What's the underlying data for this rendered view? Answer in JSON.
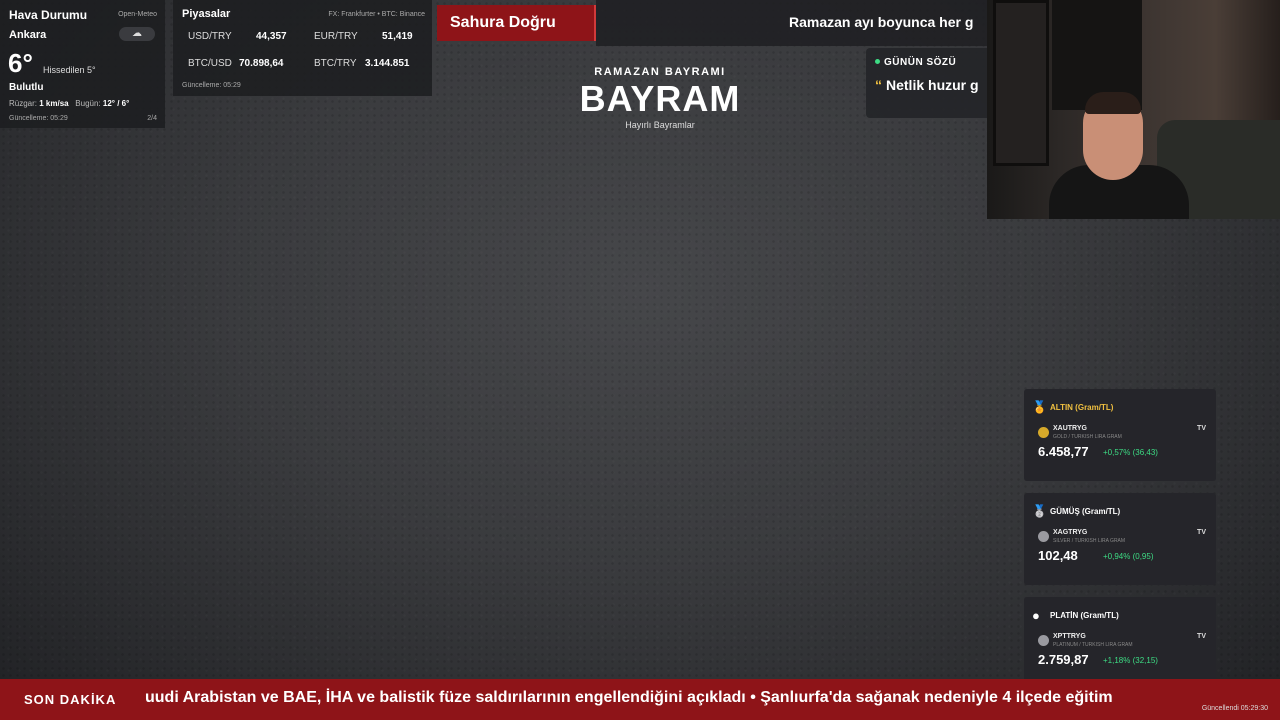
{
  "weather": {
    "title": "Hava Durumu",
    "source": "Open-Meteo",
    "city": "Ankara",
    "icon": "cloud-icon",
    "temperature": "6°",
    "feels_like": "Hissedilen 5°",
    "condition": "Bulutlu",
    "wind_label": "Rüzgar:",
    "wind_value": "1 km/sa",
    "today_label": "Bugün:",
    "today_value": "12° / 6°",
    "updated": "Güncelleme: 05:29",
    "page": "2/4"
  },
  "markets": {
    "title": "Piyasalar",
    "source": "FX: Frankfurter • BTC: Binance",
    "rates": [
      {
        "pair": "USD/TRY",
        "value": "44,357"
      },
      {
        "pair": "EUR/TRY",
        "value": "51,419"
      },
      {
        "pair": "BTC/USD",
        "value": "70.898,64"
      },
      {
        "pair": "BTC/TRY",
        "value": "3.144.851"
      }
    ],
    "updated": "Güncelleme: 05:29"
  },
  "sahur": {
    "label": "Sahura Doğru"
  },
  "top_ticker": {
    "text": "Ramazan ayı boyunca her g"
  },
  "center": {
    "subtitle": "RAMAZAN BAYRAMI",
    "title": "BAYRAM",
    "note": "Hayırlı Bayramlar"
  },
  "quote": {
    "heading": "GÜNÜN SÖZÜ",
    "mark": "“",
    "text": "Netlik huzur g"
  },
  "metals": {
    "items": [
      {
        "heading": "ALTIN (Gram/TL)",
        "icon": "medal-gold-icon",
        "symbol": "XAUTRYG",
        "description": "GOLD / TURKISH LIRA GRAM",
        "value": "6.458,77",
        "change": "+0,57% (36,43)",
        "coin_color": "#d6a92a"
      },
      {
        "heading": "GÜMÜŞ (Gram/TL)",
        "icon": "medal-silver-icon",
        "symbol": "XAGTRYG",
        "description": "SILVER / TURKISH LIRA GRAM",
        "value": "102,48",
        "change": "+0,94% (0,95)",
        "coin_color": "#9a9aa0"
      },
      {
        "heading": "PLATİN (Gram/TL)",
        "icon": "circle-white-icon",
        "symbol": "XPTTRYG",
        "description": "PLATINUM / TURKISH LIRA GRAM",
        "value": "2.759,87",
        "change": "+1,18% (32,15)",
        "coin_color": "#9a9aa0"
      }
    ],
    "tv_label": "TV",
    "updated": "Güncellendi 05:29:30"
  },
  "bottom_ticker": {
    "label": "SON DAKİKA",
    "news": "uudi Arabistan ve BAE, İHA ve balistik füze saldırılarının engellendiğini açıkladı   •   Şanlıurfa'da sağanak nedeniyle 4 ilçede eğitim"
  },
  "colors": {
    "accent_red": "#8e1418",
    "positive": "#3ddc84",
    "gold": "#f0c040"
  }
}
